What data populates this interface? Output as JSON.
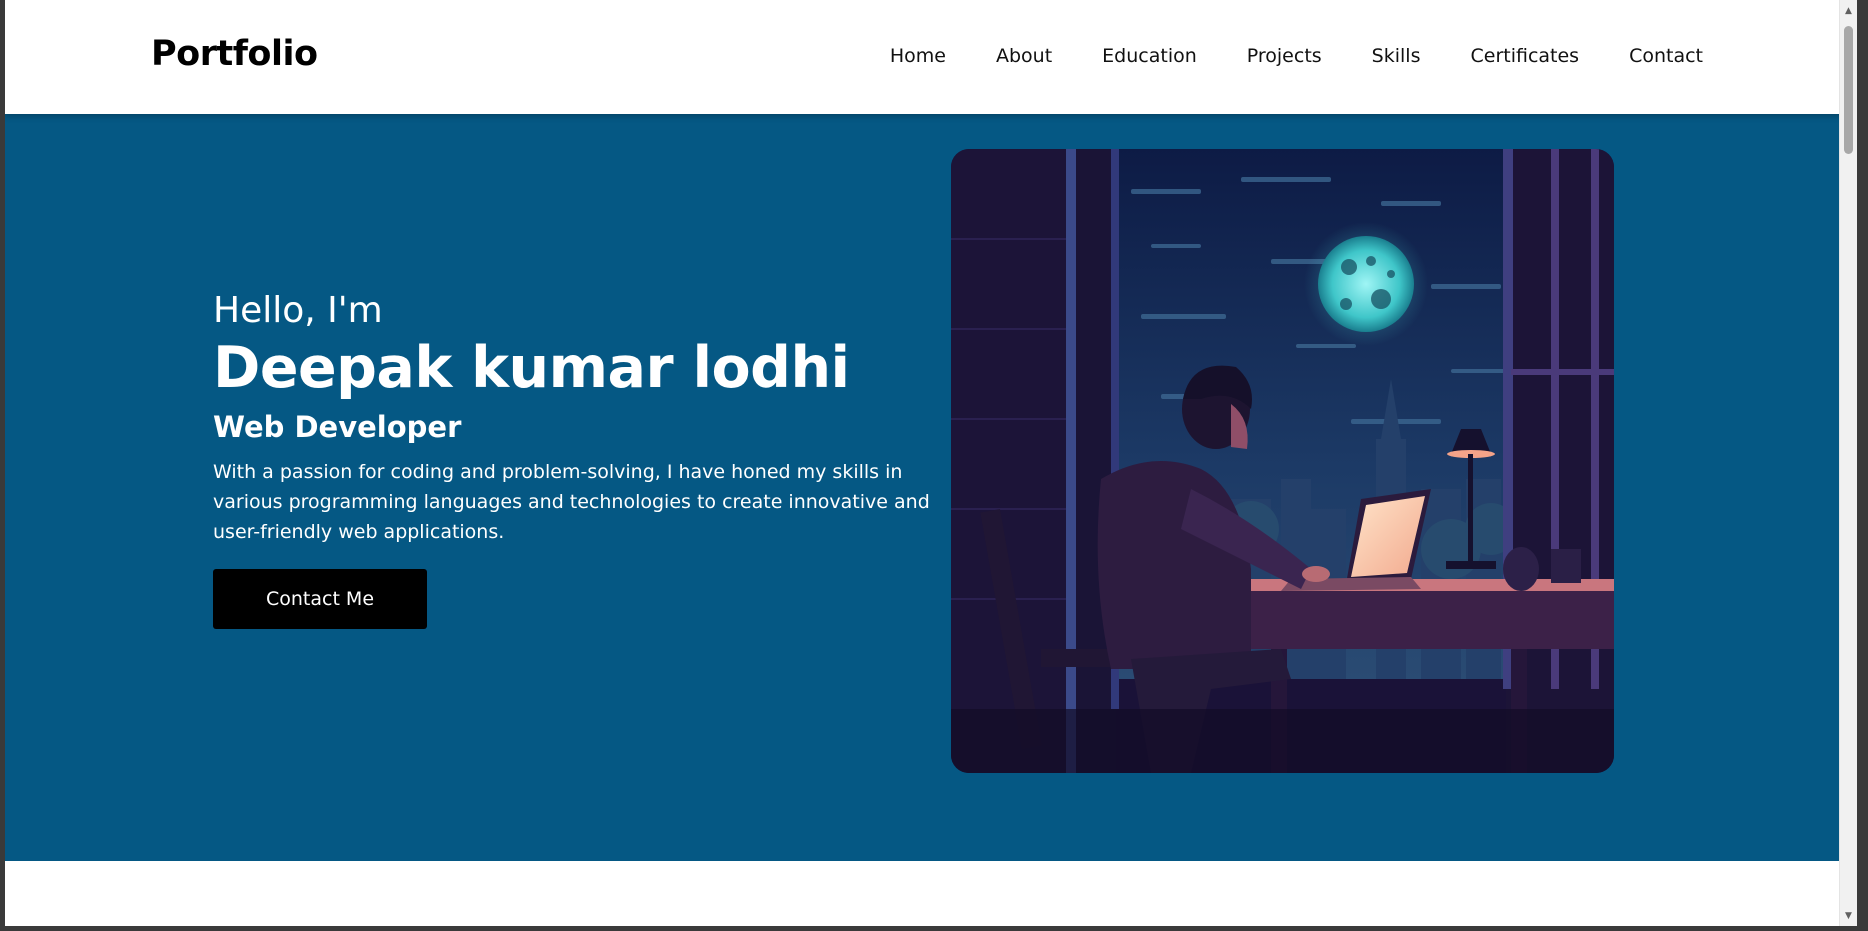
{
  "header": {
    "brand": "Portfolio",
    "nav": [
      "Home",
      "About",
      "Education",
      "Projects",
      "Skills",
      "Certificates",
      "Contact"
    ]
  },
  "hero": {
    "greeting": "Hello, I'm",
    "name": "Deepak kumar lodhi",
    "role": "Web Developer",
    "bio": "With a passion for coding and problem-solving, I have honed my skills in various programming languages and technologies to create innovative and user-friendly web applications.",
    "cta": "Contact Me",
    "image_subject": "person-coding-at-night-illustration"
  },
  "colors": {
    "hero_bg": "#055884",
    "header_bg": "#ffffff",
    "button_bg": "#000000",
    "text_light": "#ffffff"
  },
  "icons": {
    "scroll_up": "chevron-up-icon",
    "scroll_down": "chevron-down-icon"
  }
}
